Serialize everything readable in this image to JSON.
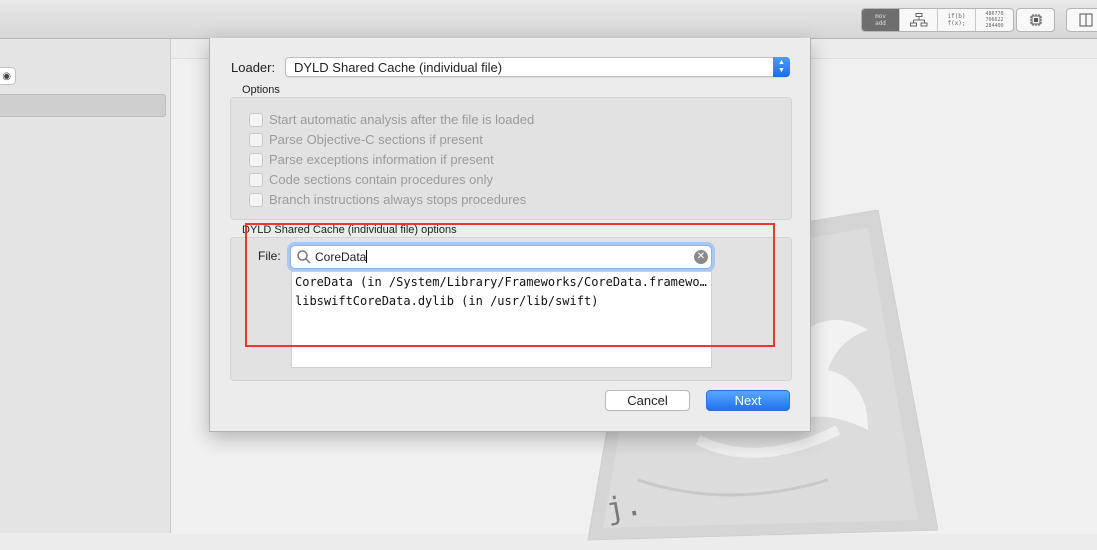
{
  "toolbar": {
    "segments": [
      {
        "icon": "mov-add-asm-icon",
        "text": "mov\nadd"
      },
      {
        "icon": "cfg-graph-icon",
        "text": ""
      },
      {
        "icon": "pseudocode-icon",
        "text": "if(b)\nf(x);"
      },
      {
        "icon": "hex-view-icon",
        "text": "486770\n706622\n284400"
      }
    ],
    "chip_icon": "cpu-chip-icon",
    "panel_icon": "sidebar-toggle-icon"
  },
  "dialog": {
    "loader_label": "Loader:",
    "loader_value": "DYLD Shared Cache (individual file)",
    "options_title": "Options",
    "options": [
      "Start automatic analysis after the file is loaded",
      "Parse Objective-C sections if present",
      "Parse exceptions information if present",
      "Code sections contain procedures only",
      "Branch instructions always stops procedures"
    ],
    "dyld_title": "DYLD Shared Cache (individual file) options",
    "file_label": "File:",
    "search_value": "CoreData",
    "results": [
      "CoreData (in /System/Library/Frameworks/CoreData.framework)",
      "libswiftCoreData.dylib (in /usr/lib/swift)"
    ],
    "cancel_label": "Cancel",
    "next_label": "Next"
  },
  "colors": {
    "accent": "#1f74f0",
    "highlight": "#e53a2e"
  }
}
